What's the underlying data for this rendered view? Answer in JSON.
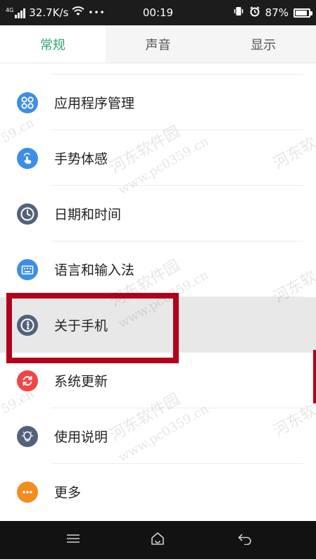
{
  "status_bar": {
    "network": "4G",
    "speed": "32.7K/s",
    "more": "•••",
    "time": "00:19",
    "battery": "87%",
    "battery_level": 0.87
  },
  "tabs": [
    {
      "label": "常规",
      "active": true
    },
    {
      "label": "声音",
      "active": false
    },
    {
      "label": "显示",
      "active": false
    }
  ],
  "items": [
    {
      "label": "应用程序管理",
      "icon": "app-management-icon",
      "color": "#3d8ee6"
    },
    {
      "label": "手势体感",
      "icon": "gesture-icon",
      "color": "#3d8ee6"
    },
    {
      "label": "日期和时间",
      "icon": "clock-icon",
      "color": "#52627a"
    },
    {
      "label": "语言和输入法",
      "icon": "keyboard-icon",
      "color": "#3d8ee6"
    },
    {
      "label": "关于手机",
      "icon": "info-icon",
      "color": "#52627a",
      "selected": true
    },
    {
      "label": "系统更新",
      "icon": "update-icon",
      "color": "#f04646"
    },
    {
      "label": "使用说明",
      "icon": "lightbulb-icon",
      "color": "#52627a"
    },
    {
      "label": "更多",
      "icon": "more-icon",
      "color": "#f28d1e"
    }
  ],
  "watermark": {
    "text1": "河东软件园",
    "text2": "www.pc0359.cn",
    "text3": "59.cn",
    "text4": "河东软"
  },
  "accent_color": "#2ea675",
  "highlight_color": "#b3001b"
}
